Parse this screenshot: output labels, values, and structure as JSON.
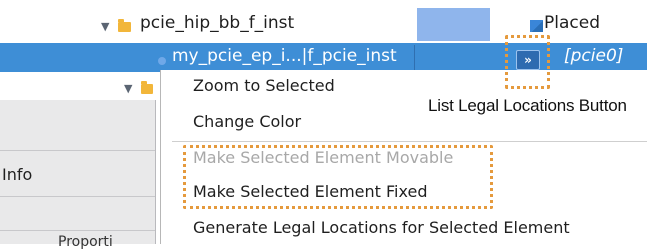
{
  "tree": {
    "parent_label": "pcie_hip_bb_f_inst",
    "parent_status": "Placed",
    "selected_label": "my_pcie_ep_i...|f_pcie_inst",
    "selected_location": "[pcie0]"
  },
  "left_panel": {
    "info_label": "Info",
    "partial_label": "Proporti"
  },
  "context_menu": {
    "items": [
      {
        "label": "Zoom to Selected",
        "enabled": true
      },
      {
        "label": "Change Color",
        "enabled": true
      },
      {
        "label": "Make Selected Element Movable",
        "enabled": false
      },
      {
        "label": "Make Selected Element Fixed",
        "enabled": true
      },
      {
        "label": "Generate Legal Locations for Selected Element",
        "enabled": true
      }
    ]
  },
  "annotation": {
    "label": "List Legal Locations Button",
    "color": "#e59a3d"
  },
  "icons": {
    "legal_button_glyph": "»"
  },
  "colors": {
    "selection": "#3e8ed6",
    "column_highlight": "#8fb5ec",
    "folder": "#f2b63a"
  }
}
